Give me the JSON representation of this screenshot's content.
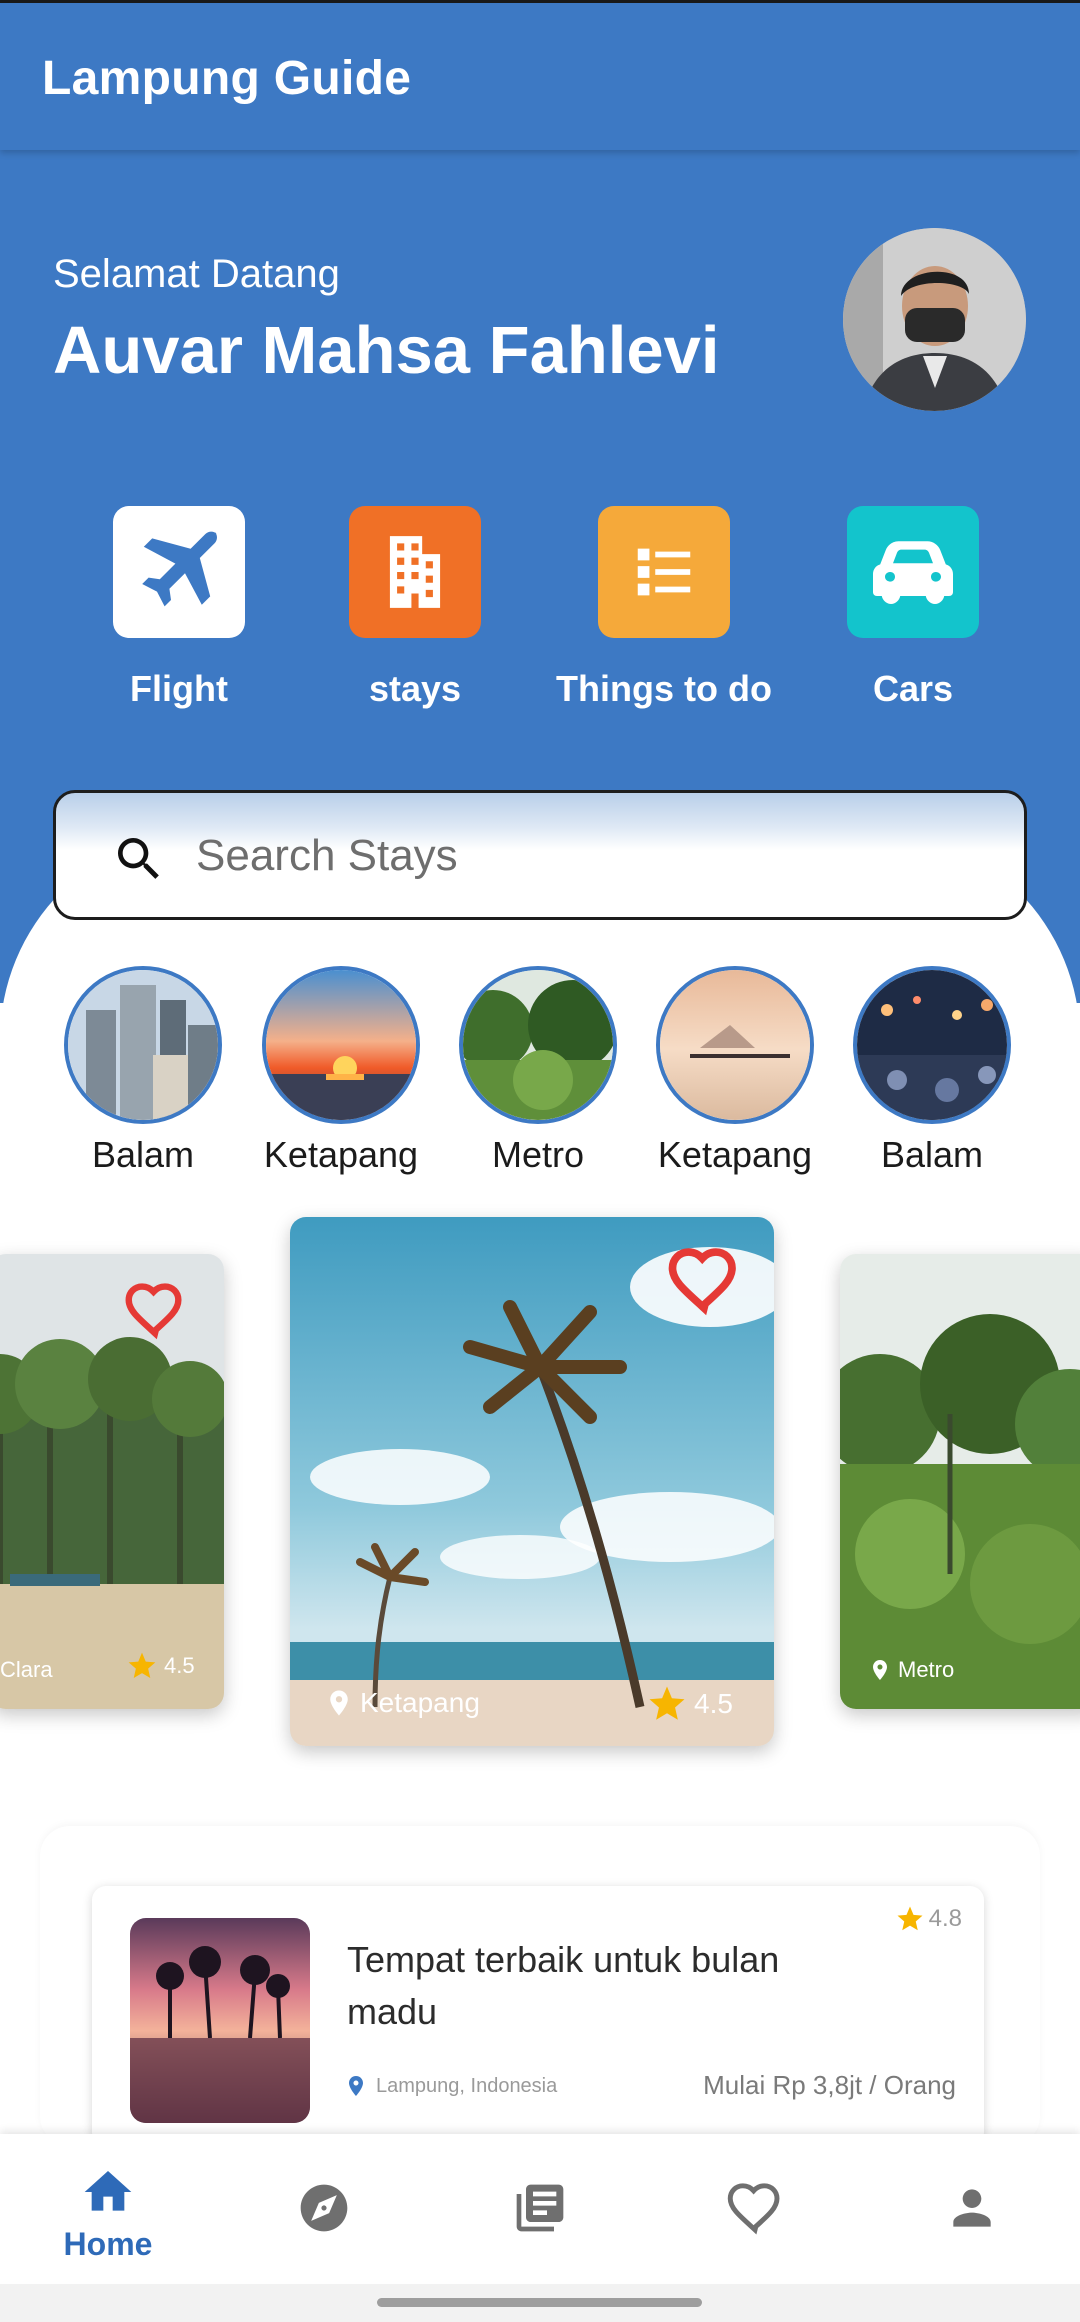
{
  "app": {
    "title": "Lampung Guide"
  },
  "header": {
    "greeting": "Selamat Datang",
    "user_name": "Auvar Mahsa Fahlevi"
  },
  "categories": [
    {
      "label": "Flight",
      "icon": "airplane-icon",
      "color": "#ffffff"
    },
    {
      "label": "stays",
      "icon": "building-icon",
      "color": "#f07026"
    },
    {
      "label": "Things to do",
      "icon": "list-icon",
      "color": "#f5a93a"
    },
    {
      "label": "Cars",
      "icon": "car-icon",
      "color": "#13c4cc"
    }
  ],
  "search": {
    "placeholder": "Search Stays",
    "value": ""
  },
  "places": [
    {
      "label": "Balam"
    },
    {
      "label": "Ketapang"
    },
    {
      "label": "Metro"
    },
    {
      "label": "Ketapang"
    },
    {
      "label": "Balam"
    }
  ],
  "carousel": [
    {
      "location": "Clara",
      "rating": "4.5"
    },
    {
      "location": "Ketapang",
      "rating": "4.5"
    },
    {
      "location": "Metro"
    }
  ],
  "recommendation": {
    "title": "Tempat terbaik untuk bulan madu",
    "rating": "4.8",
    "location": "Lampung, Indonesia",
    "price": "Mulai Rp 3,8jt / Orang"
  },
  "bottom_nav": [
    {
      "label": "Home",
      "icon": "home-icon",
      "active": true
    },
    {
      "label": "",
      "icon": "compass-icon"
    },
    {
      "label": "",
      "icon": "library-icon"
    },
    {
      "label": "",
      "icon": "heart-icon"
    },
    {
      "label": "",
      "icon": "person-icon"
    }
  ],
  "colors": {
    "primary": "#3d79c4",
    "heart": "#e53935",
    "star": "#f7b500"
  }
}
